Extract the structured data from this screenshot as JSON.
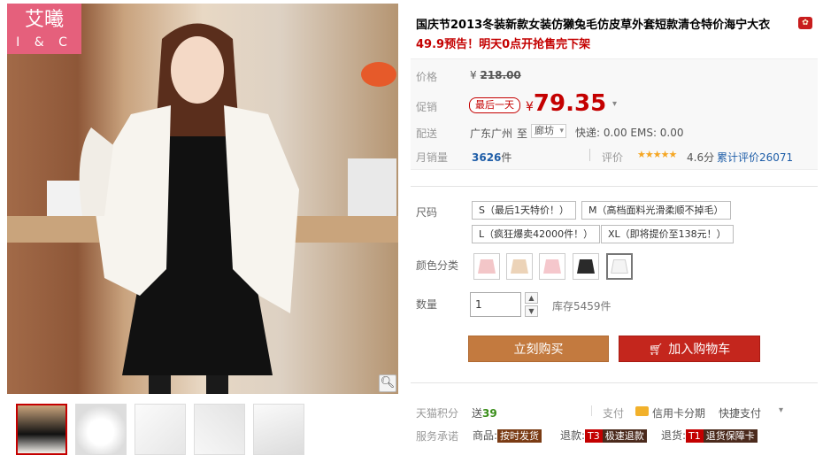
{
  "gallery": {
    "brand_cn": "艾曦",
    "brand_en": "I & C",
    "zoom_icon": "magnifier-icon",
    "thumbnails": 5
  },
  "product": {
    "title": "国庆节2013冬装新款女装仿獭兔毛仿皮草外套短款清仓特价海宁大衣",
    "subtitle": "49.9预告！明天0点开抢售完下架"
  },
  "price": {
    "label": "价格",
    "currency": "¥",
    "original": "218.00",
    "promo_label": "促销",
    "promo_badge": "最后一天",
    "promo_price": "79.35"
  },
  "shipping": {
    "label": "配送",
    "from": "广东广州",
    "to_word": "至",
    "dest": "廊坊",
    "fees": "快递: 0.00 EMS: 0.00"
  },
  "sales": {
    "label": "月销量",
    "count": "3626",
    "unit": "件",
    "rating_label": "评价",
    "stars": "★★★★★",
    "score": "4.6分",
    "total_reviews": "累计评价26071"
  },
  "size": {
    "label": "尺码",
    "options": [
      "S（最后1天特价！）",
      "M（高档面料光滑柔顺不掉毛）",
      "L（疯狂爆卖42000件！）",
      "XL（即将提价至138元！）"
    ]
  },
  "color": {
    "label": "颜色分类",
    "swatches": [
      "#f3c6c8",
      "#ecd3b8",
      "#f5c7cc",
      "#2a2a2a",
      "#f4f4f4"
    ]
  },
  "quantity": {
    "label": "数量",
    "value": "1",
    "stock": "库存5459件"
  },
  "actions": {
    "buy_now": "立刻购买",
    "add_to_cart": "加入购物车"
  },
  "footer": {
    "points_label": "天猫积分",
    "points_prefix": "送",
    "points_value": "39",
    "pay_label": "支付",
    "credit_installment": "信用卡分期",
    "quick_pay": "快捷支付",
    "service_label": "服务承诺",
    "goods_label": "商品:",
    "goods_tag": "按时发货",
    "refund_label": "退款:",
    "refund_code": "T3",
    "refund_tag": "极速退款",
    "return_label": "退货:",
    "return_code": "T1",
    "return_tag": "退货保障卡"
  }
}
